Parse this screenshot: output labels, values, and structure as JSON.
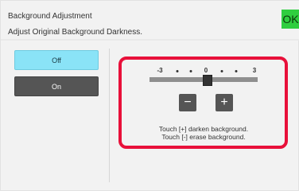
{
  "header": {
    "title": "Background Adjustment",
    "subtitle": "Adjust Original Background Darkness.",
    "ok_label": "OK"
  },
  "options": {
    "off_label": "Off",
    "on_label": "On",
    "selected": "Off"
  },
  "slider": {
    "min_label": "-3",
    "mid_label": "0",
    "max_label": "3",
    "value": 0,
    "min": -3,
    "max": 3
  },
  "stepper": {
    "minus_label": "−",
    "plus_label": "+"
  },
  "help": {
    "line1": "Touch [+] darken background.",
    "line2": "Touch [-] erase background."
  },
  "colors": {
    "ok_green": "#2fce3f",
    "selected_cyan": "#8ae3f7",
    "highlight_red": "#e8103a"
  }
}
